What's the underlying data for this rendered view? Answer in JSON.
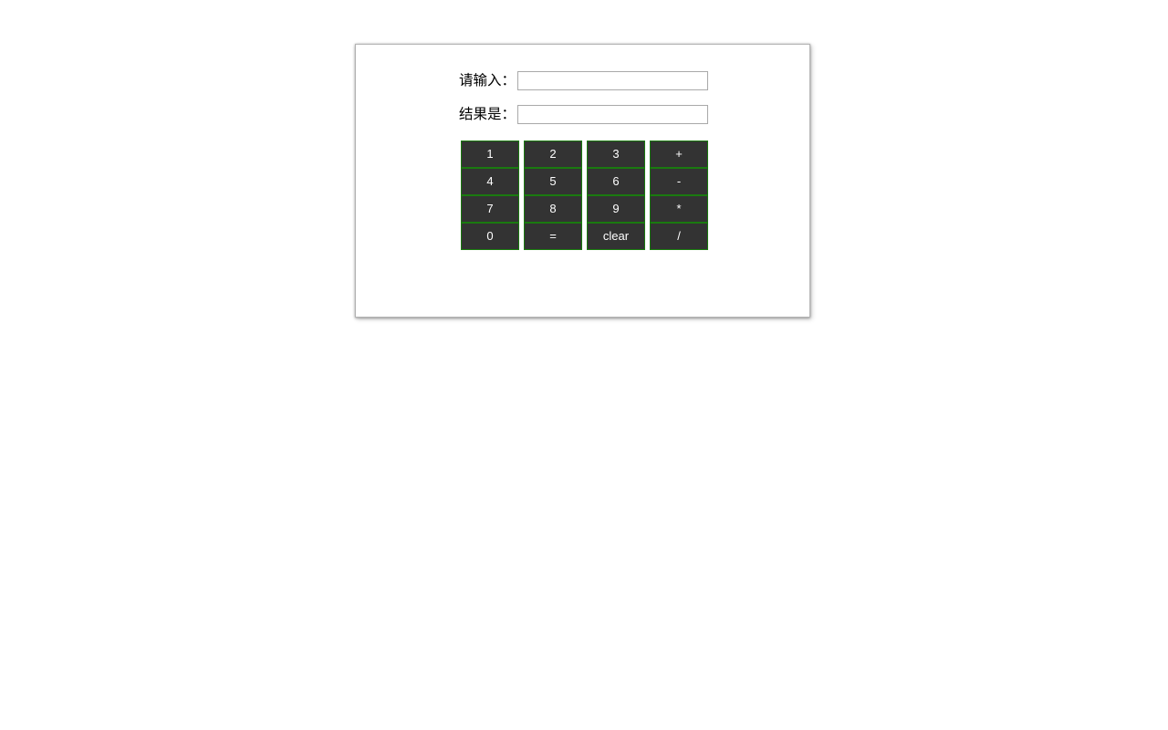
{
  "page": {
    "background_color": "#ffffff"
  },
  "panel": {
    "border_color": "#b4b4b4",
    "background_color": "#ffffff"
  },
  "form": {
    "rows": [
      {
        "label": "请输入：",
        "value": "",
        "placeholder": ""
      },
      {
        "label": "结果是：",
        "value": "",
        "placeholder": ""
      }
    ]
  },
  "keypad": {
    "button_background": "#333333",
    "button_border_color": "#1a7a0f",
    "button_text_color": "#ffffff",
    "columns": [
      {
        "keys": [
          "1",
          "4",
          "7",
          "0"
        ]
      },
      {
        "keys": [
          "2",
          "5",
          "8",
          "="
        ]
      },
      {
        "keys": [
          "3",
          "6",
          "9",
          "clear"
        ]
      },
      {
        "keys": [
          "+",
          "-",
          "*",
          "/"
        ]
      }
    ]
  }
}
